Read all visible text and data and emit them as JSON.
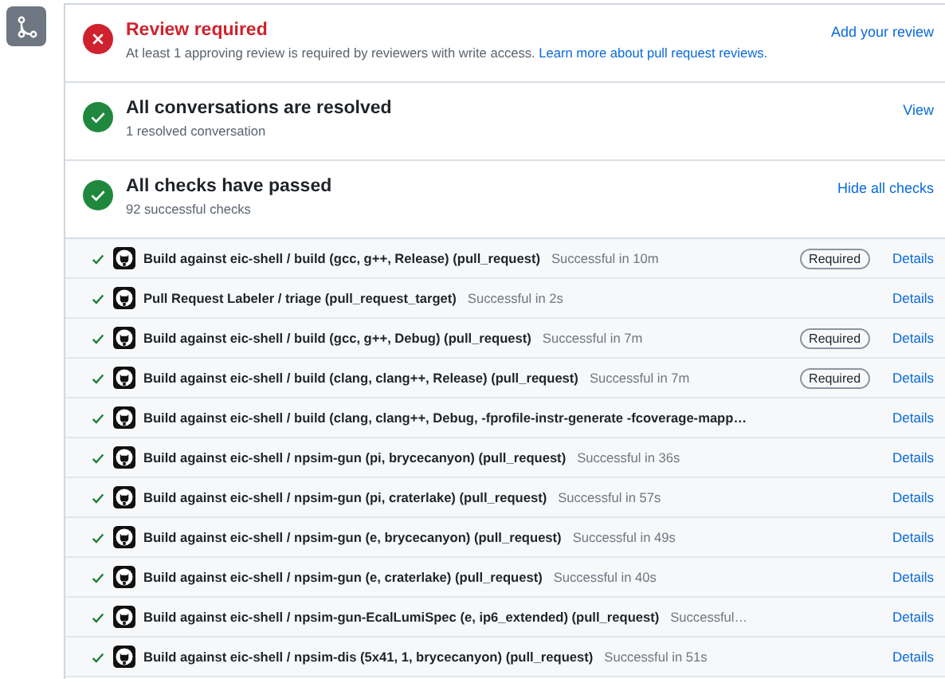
{
  "sections": [
    {
      "passed": false,
      "title": "Review required",
      "description": "At least 1 approving review is required by reviewers with write access. ",
      "link": "Learn more about pull request reviews.",
      "action": "Add your review"
    },
    {
      "passed": true,
      "title": "All conversations are resolved",
      "description": "1 resolved conversation",
      "action": "View"
    },
    {
      "passed": true,
      "title": "All checks have passed",
      "description": "92 successful checks",
      "action": "Hide all checks"
    }
  ],
  "checks": [
    {
      "passed": true,
      "name": "Build against eic-shell / build (gcc, g++, Release) (pull_request)",
      "result": "Successful in 10m",
      "badge": "Required",
      "action": "Details"
    },
    {
      "passed": true,
      "name": "Pull Request Labeler / triage (pull_request_target)",
      "result": "Successful in 2s",
      "action": "Details"
    },
    {
      "passed": true,
      "name": "Build against eic-shell / build (gcc, g++, Debug) (pull_request)",
      "result": "Successful in 7m",
      "badge": "Required",
      "action": "Details"
    },
    {
      "passed": true,
      "name": "Build against eic-shell / build (clang, clang++, Release) (pull_request)",
      "result": "Successful in 7m",
      "badge": "Required",
      "action": "Details"
    },
    {
      "passed": true,
      "name": "Build against eic-shell / build (clang, clang++, Debug, -fprofile-instr-generate -fcoverage-mapp…",
      "action": "Details"
    },
    {
      "passed": true,
      "name": "Build against eic-shell / npsim-gun (pi, brycecanyon) (pull_request)",
      "result": "Successful in 36s",
      "action": "Details"
    },
    {
      "passed": true,
      "name": "Build against eic-shell / npsim-gun (pi, craterlake) (pull_request)",
      "result": "Successful in 57s",
      "action": "Details"
    },
    {
      "passed": true,
      "name": "Build against eic-shell / npsim-gun (e, brycecanyon) (pull_request)",
      "result": "Successful in 49s",
      "action": "Details"
    },
    {
      "passed": true,
      "name": "Build against eic-shell / npsim-gun (e, craterlake) (pull_request)",
      "result": "Successful in 40s",
      "action": "Details"
    },
    {
      "passed": true,
      "name": "Build against eic-shell / npsim-gun-EcalLumiSpec (e, ip6_extended) (pull_request)",
      "result": "Successful…",
      "action": "Details"
    },
    {
      "passed": true,
      "name": "Build against eic-shell / npsim-dis (5x41, 1, brycecanyon) (pull_request)",
      "result": "Successful in 51s",
      "action": "Details"
    }
  ]
}
